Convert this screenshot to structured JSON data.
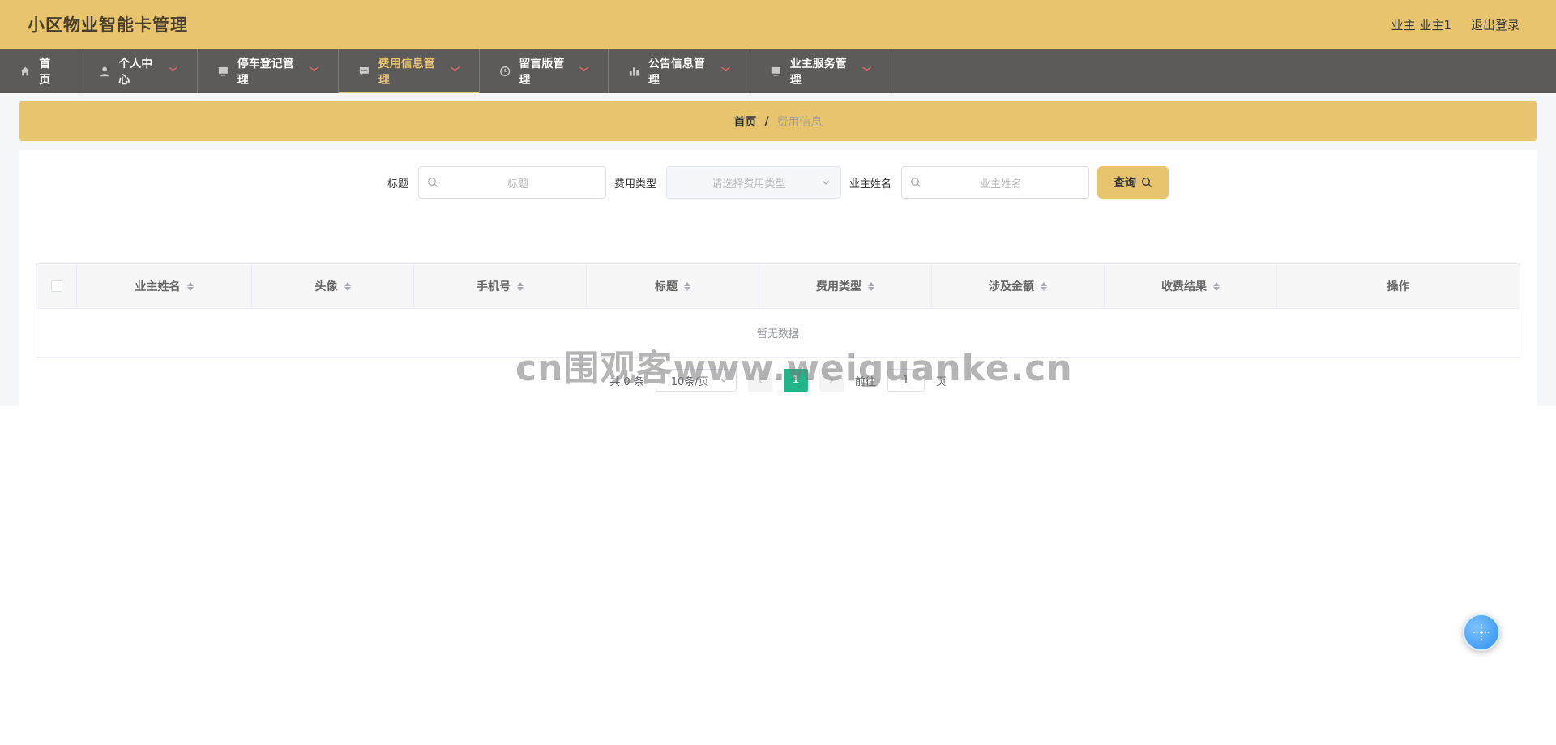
{
  "header": {
    "title": "小区物业智能卡管理",
    "user_label": "业主 业主1",
    "logout_label": "退出登录"
  },
  "nav": {
    "items": [
      {
        "label": "首页",
        "icon": "home-icon",
        "has_dropdown": false,
        "active": false
      },
      {
        "label": "个人中心",
        "icon": "user-icon",
        "has_dropdown": true,
        "active": false
      },
      {
        "label": "停车登记管理",
        "icon": "monitor-icon",
        "has_dropdown": true,
        "active": false
      },
      {
        "label": "费用信息管理",
        "icon": "message-icon",
        "has_dropdown": true,
        "active": true
      },
      {
        "label": "留言版管理",
        "icon": "clock-icon",
        "has_dropdown": true,
        "active": false
      },
      {
        "label": "公告信息管理",
        "icon": "chart-icon",
        "has_dropdown": true,
        "active": false
      },
      {
        "label": "业主服务管理",
        "icon": "monitor-icon",
        "has_dropdown": true,
        "active": false
      }
    ]
  },
  "breadcrumb": {
    "home": "首页",
    "separator": "/",
    "current": "费用信息"
  },
  "search": {
    "title_label": "标题",
    "title_placeholder": "标题",
    "type_label": "费用类型",
    "type_placeholder": "请选择费用类型",
    "owner_label": "业主姓名",
    "owner_placeholder": "业主姓名",
    "query_label": "查询"
  },
  "table": {
    "columns": [
      "业主姓名",
      "头像",
      "手机号",
      "标题",
      "费用类型",
      "涉及金额",
      "收费结果",
      "操作"
    ],
    "empty_text": "暂无数据"
  },
  "pagination": {
    "total_text": "共 0 条",
    "page_size": "10条/页",
    "current_page": "1",
    "goto_label": "前往",
    "goto_value": "1",
    "page_suffix": "页"
  },
  "watermark": "cn围观客www.weiguanke.cn",
  "colors": {
    "accent": "#e8c46e",
    "nav_bg": "#5c5b5a",
    "page_active": "#21b68a"
  }
}
